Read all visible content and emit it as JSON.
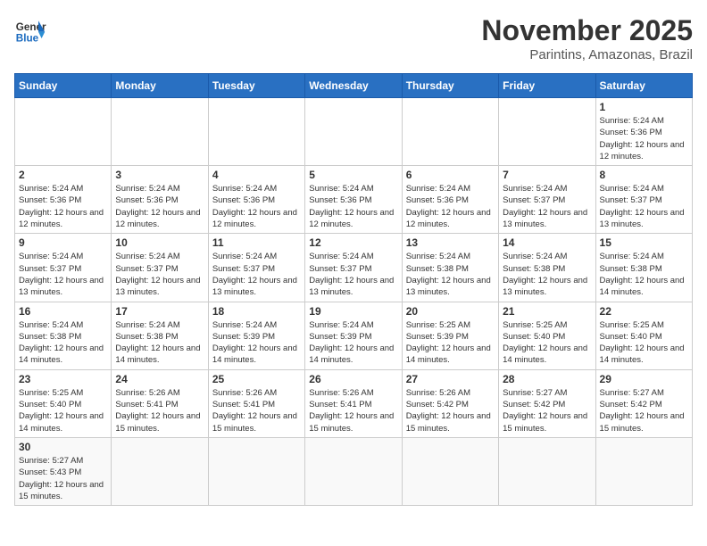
{
  "header": {
    "logo_general": "General",
    "logo_blue": "Blue",
    "month_title": "November 2025",
    "location": "Parintins, Amazonas, Brazil"
  },
  "weekdays": [
    "Sunday",
    "Monday",
    "Tuesday",
    "Wednesday",
    "Thursday",
    "Friday",
    "Saturday"
  ],
  "weeks": [
    [
      {
        "day": "",
        "info": ""
      },
      {
        "day": "",
        "info": ""
      },
      {
        "day": "",
        "info": ""
      },
      {
        "day": "",
        "info": ""
      },
      {
        "day": "",
        "info": ""
      },
      {
        "day": "",
        "info": ""
      },
      {
        "day": "1",
        "info": "Sunrise: 5:24 AM\nSunset: 5:36 PM\nDaylight: 12 hours and 12 minutes."
      }
    ],
    [
      {
        "day": "2",
        "info": "Sunrise: 5:24 AM\nSunset: 5:36 PM\nDaylight: 12 hours and 12 minutes."
      },
      {
        "day": "3",
        "info": "Sunrise: 5:24 AM\nSunset: 5:36 PM\nDaylight: 12 hours and 12 minutes."
      },
      {
        "day": "4",
        "info": "Sunrise: 5:24 AM\nSunset: 5:36 PM\nDaylight: 12 hours and 12 minutes."
      },
      {
        "day": "5",
        "info": "Sunrise: 5:24 AM\nSunset: 5:36 PM\nDaylight: 12 hours and 12 minutes."
      },
      {
        "day": "6",
        "info": "Sunrise: 5:24 AM\nSunset: 5:36 PM\nDaylight: 12 hours and 12 minutes."
      },
      {
        "day": "7",
        "info": "Sunrise: 5:24 AM\nSunset: 5:37 PM\nDaylight: 12 hours and 13 minutes."
      },
      {
        "day": "8",
        "info": "Sunrise: 5:24 AM\nSunset: 5:37 PM\nDaylight: 12 hours and 13 minutes."
      }
    ],
    [
      {
        "day": "9",
        "info": "Sunrise: 5:24 AM\nSunset: 5:37 PM\nDaylight: 12 hours and 13 minutes."
      },
      {
        "day": "10",
        "info": "Sunrise: 5:24 AM\nSunset: 5:37 PM\nDaylight: 12 hours and 13 minutes."
      },
      {
        "day": "11",
        "info": "Sunrise: 5:24 AM\nSunset: 5:37 PM\nDaylight: 12 hours and 13 minutes."
      },
      {
        "day": "12",
        "info": "Sunrise: 5:24 AM\nSunset: 5:37 PM\nDaylight: 12 hours and 13 minutes."
      },
      {
        "day": "13",
        "info": "Sunrise: 5:24 AM\nSunset: 5:38 PM\nDaylight: 12 hours and 13 minutes."
      },
      {
        "day": "14",
        "info": "Sunrise: 5:24 AM\nSunset: 5:38 PM\nDaylight: 12 hours and 13 minutes."
      },
      {
        "day": "15",
        "info": "Sunrise: 5:24 AM\nSunset: 5:38 PM\nDaylight: 12 hours and 14 minutes."
      }
    ],
    [
      {
        "day": "16",
        "info": "Sunrise: 5:24 AM\nSunset: 5:38 PM\nDaylight: 12 hours and 14 minutes."
      },
      {
        "day": "17",
        "info": "Sunrise: 5:24 AM\nSunset: 5:38 PM\nDaylight: 12 hours and 14 minutes."
      },
      {
        "day": "18",
        "info": "Sunrise: 5:24 AM\nSunset: 5:39 PM\nDaylight: 12 hours and 14 minutes."
      },
      {
        "day": "19",
        "info": "Sunrise: 5:24 AM\nSunset: 5:39 PM\nDaylight: 12 hours and 14 minutes."
      },
      {
        "day": "20",
        "info": "Sunrise: 5:25 AM\nSunset: 5:39 PM\nDaylight: 12 hours and 14 minutes."
      },
      {
        "day": "21",
        "info": "Sunrise: 5:25 AM\nSunset: 5:40 PM\nDaylight: 12 hours and 14 minutes."
      },
      {
        "day": "22",
        "info": "Sunrise: 5:25 AM\nSunset: 5:40 PM\nDaylight: 12 hours and 14 minutes."
      }
    ],
    [
      {
        "day": "23",
        "info": "Sunrise: 5:25 AM\nSunset: 5:40 PM\nDaylight: 12 hours and 14 minutes."
      },
      {
        "day": "24",
        "info": "Sunrise: 5:26 AM\nSunset: 5:41 PM\nDaylight: 12 hours and 15 minutes."
      },
      {
        "day": "25",
        "info": "Sunrise: 5:26 AM\nSunset: 5:41 PM\nDaylight: 12 hours and 15 minutes."
      },
      {
        "day": "26",
        "info": "Sunrise: 5:26 AM\nSunset: 5:41 PM\nDaylight: 12 hours and 15 minutes."
      },
      {
        "day": "27",
        "info": "Sunrise: 5:26 AM\nSunset: 5:42 PM\nDaylight: 12 hours and 15 minutes."
      },
      {
        "day": "28",
        "info": "Sunrise: 5:27 AM\nSunset: 5:42 PM\nDaylight: 12 hours and 15 minutes."
      },
      {
        "day": "29",
        "info": "Sunrise: 5:27 AM\nSunset: 5:42 PM\nDaylight: 12 hours and 15 minutes."
      }
    ],
    [
      {
        "day": "30",
        "info": "Sunrise: 5:27 AM\nSunset: 5:43 PM\nDaylight: 12 hours and 15 minutes."
      },
      {
        "day": "",
        "info": ""
      },
      {
        "day": "",
        "info": ""
      },
      {
        "day": "",
        "info": ""
      },
      {
        "day": "",
        "info": ""
      },
      {
        "day": "",
        "info": ""
      },
      {
        "day": "",
        "info": ""
      }
    ]
  ]
}
